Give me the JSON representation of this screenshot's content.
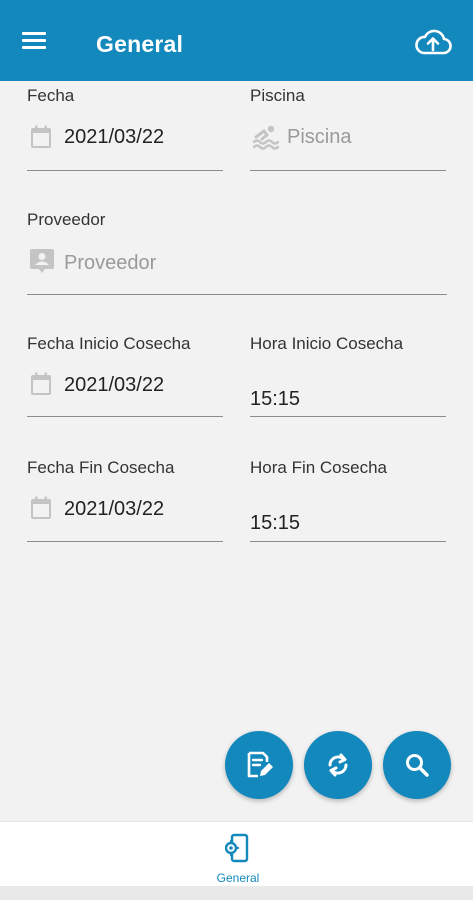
{
  "appbar": {
    "title": "General",
    "menu_icon": "menu-icon",
    "upload_icon": "cloud-upload-icon",
    "color": "#1388bd"
  },
  "form": {
    "fecha": {
      "label": "Fecha",
      "value": "2021/03/22",
      "icon": "calendar-icon"
    },
    "piscina": {
      "label": "Piscina",
      "placeholder": "Piscina",
      "icon": "swimming-icon"
    },
    "proveedor": {
      "label": "Proveedor",
      "placeholder": "Proveedor",
      "icon": "contact-icon"
    },
    "fecha_inicio": {
      "label": "Fecha Inicio Cosecha",
      "value": "2021/03/22",
      "icon": "calendar-icon"
    },
    "hora_inicio": {
      "label": "Hora Inicio Cosecha",
      "value": "15:15"
    },
    "fecha_fin": {
      "label": "Fecha Fin Cosecha",
      "value": "2021/03/22",
      "icon": "calendar-icon"
    },
    "hora_fin": {
      "label": "Hora Fin Cosecha",
      "value": "15:15"
    }
  },
  "fabs": [
    {
      "icon": "edit-note-icon"
    },
    {
      "icon": "refresh-icon"
    },
    {
      "icon": "search-icon"
    }
  ],
  "bottom_nav": {
    "items": [
      {
        "label": "General",
        "icon": "mobile-settings-icon",
        "active": true
      }
    ]
  }
}
